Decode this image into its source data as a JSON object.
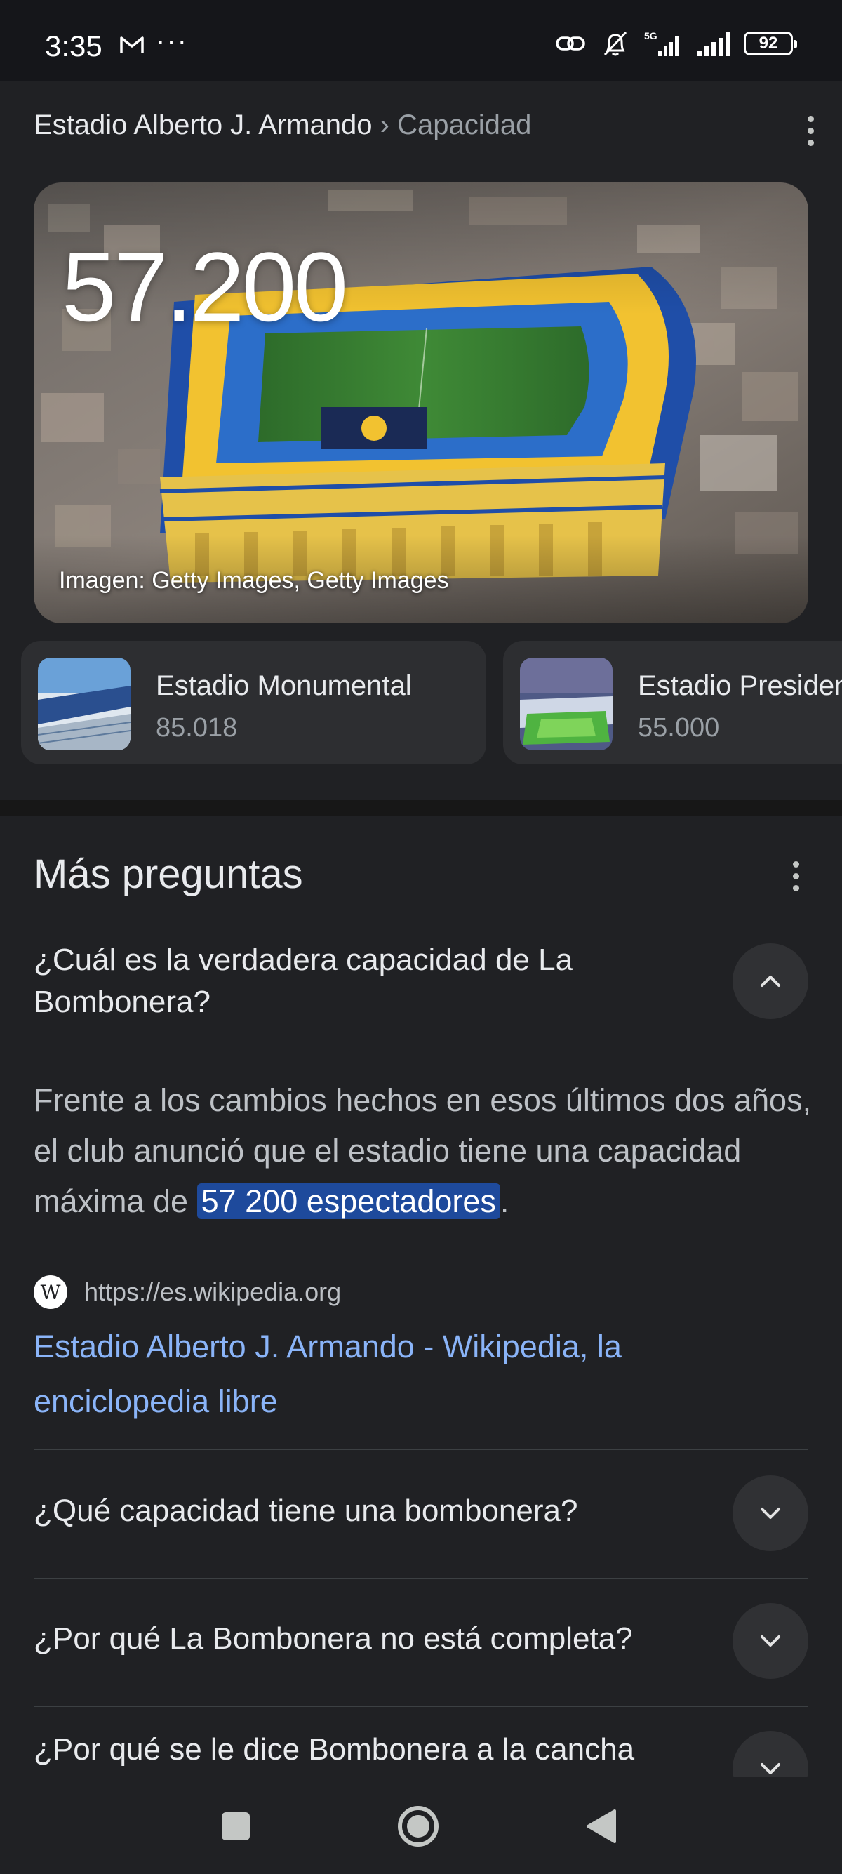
{
  "status_bar": {
    "time": "3:35",
    "notification_icons": [
      "gmail-icon",
      "more-dots-icon"
    ],
    "system_icons": [
      "link-icon",
      "bell-off-icon",
      "5g-signal-icon",
      "signal-icon"
    ],
    "overflow_dots": "···",
    "battery_level": "92"
  },
  "header": {
    "breadcrumb_main": "Estadio Alberto J. Armando",
    "breadcrumb_separator": "›",
    "breadcrumb_sub": "Capacidad"
  },
  "hero": {
    "value": "57.200",
    "image_credit": "Imagen: Getty Images, Getty Images"
  },
  "related": [
    {
      "title": "Estadio Monumental",
      "value": "85.018"
    },
    {
      "title": "Estadio Presidente Perón",
      "value": "55.000"
    }
  ],
  "more_questions": {
    "title": "Más preguntas",
    "expanded": {
      "question": "¿Cuál es la verdadera capacidad de La Bombonera?",
      "answer_before": "Frente a los cambios hechos en esos últimos dos años, el club anunció que el estadio tiene una capacidad máxima de ",
      "answer_highlight": "57 200 espectadores",
      "answer_after": ".",
      "source_icon_letter": "W",
      "source_url": "https://es.wikipedia.org",
      "source_title": "Estadio Alberto J. Armando - Wikipedia, la enciclopedia libre"
    },
    "collapsed": [
      "¿Qué capacidad tiene una bombonera?",
      "¿Por qué La Bombonera no está completa?",
      "¿Por qué se le dice Bombonera a la cancha"
    ]
  },
  "colors": {
    "background": "#202124",
    "link": "#8ab4f8",
    "highlight": "#1e4a9c",
    "stadium_yellow": "#f2c230",
    "stadium_blue": "#1f4ea8"
  }
}
